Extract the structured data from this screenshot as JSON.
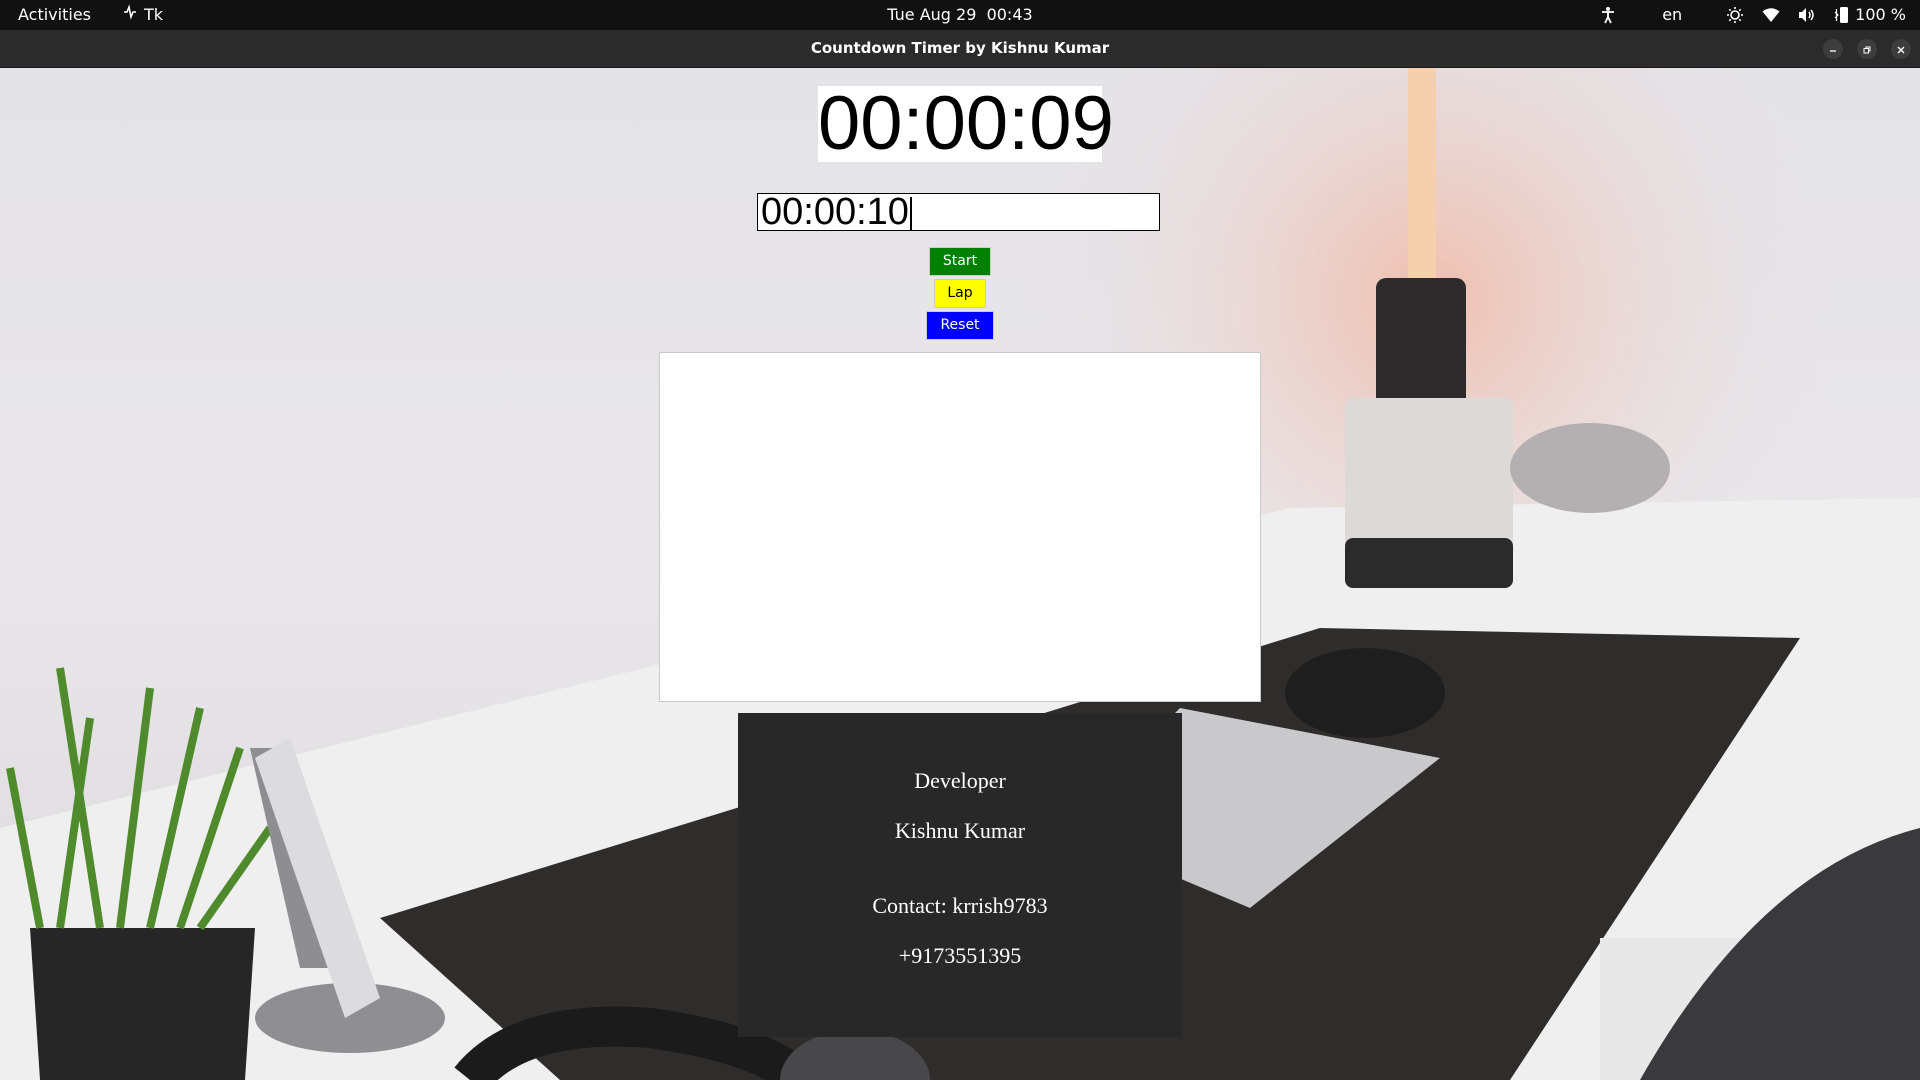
{
  "topbar": {
    "activities": "Activities",
    "app_name": "Tk",
    "clock": "Tue Aug 29  00:43",
    "language": "en",
    "battery": "100 %",
    "icons": [
      "accessibility-icon",
      "brightness-icon",
      "wifi-icon",
      "volume-icon",
      "battery-icon"
    ]
  },
  "window": {
    "title": "Countdown Timer by Kishnu Kumar"
  },
  "timer": {
    "display": "00:00:09",
    "input_value": "00:00:10"
  },
  "buttons": {
    "start": "Start",
    "lap": "Lap",
    "reset": "Reset"
  },
  "laps": [],
  "developer": {
    "heading": "Developer",
    "name": "Kishnu Kumar",
    "contact": "Contact: krrish9783",
    "phone": "+9173551395"
  },
  "colors": {
    "start": "#008000",
    "lap": "#ffff00",
    "reset": "#0000ff",
    "panel": "#282828"
  }
}
